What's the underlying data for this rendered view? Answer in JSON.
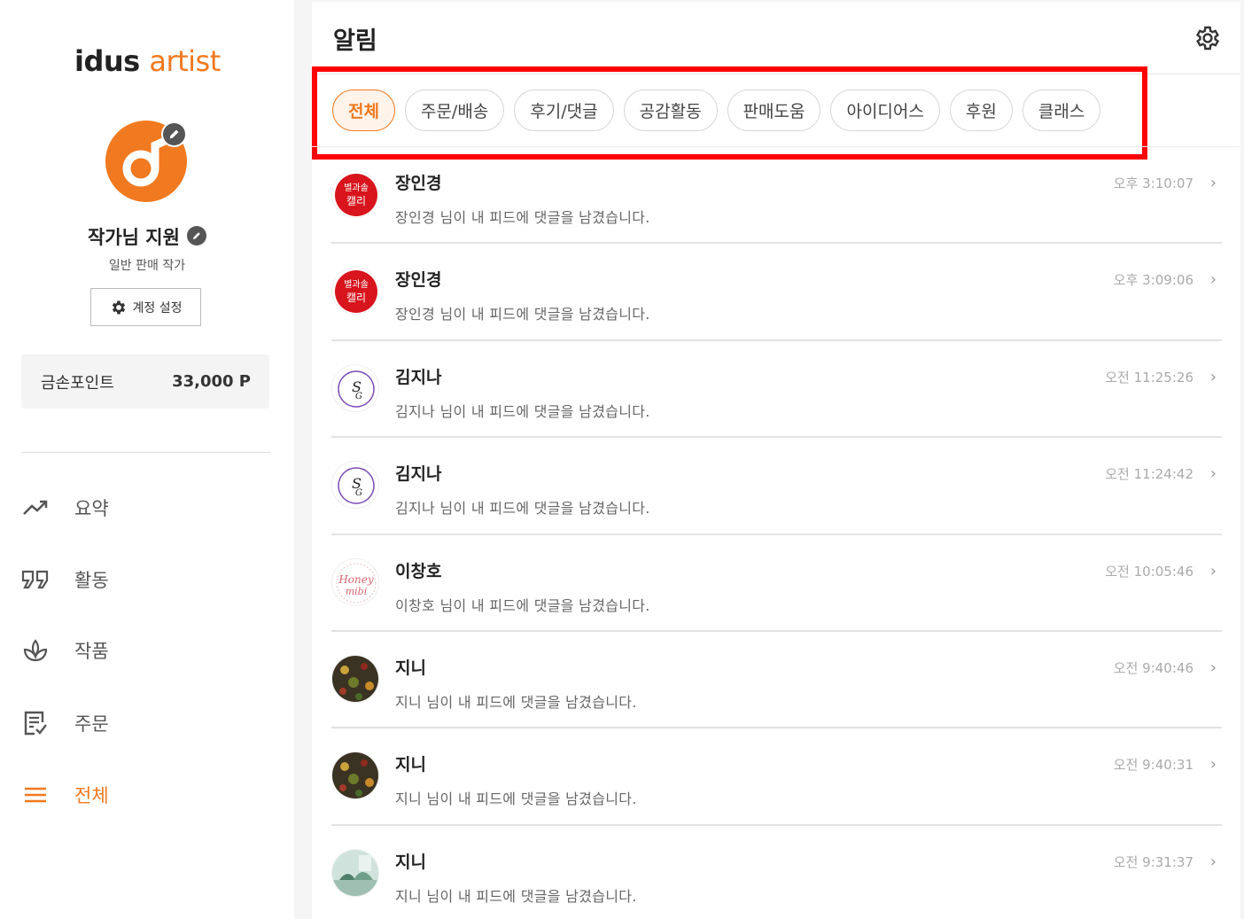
{
  "brand": {
    "logo_main": "idus",
    "logo_sub": "artist",
    "accent": "#f1791f"
  },
  "profile": {
    "name": "작가님 지원",
    "type": "일반 판매 작가",
    "account_settings": "계정 설정"
  },
  "points": {
    "label": "금손포인트",
    "value": "33,000 P"
  },
  "nav": [
    {
      "label": "요약",
      "icon": "trending-up-icon"
    },
    {
      "label": "활동",
      "icon": "quote-icon"
    },
    {
      "label": "작품",
      "icon": "plant-icon"
    },
    {
      "label": "주문",
      "icon": "order-doc-icon"
    },
    {
      "label": "전체",
      "icon": "menu-icon",
      "active": true
    }
  ],
  "main": {
    "title": "알림",
    "filters": [
      "전체",
      "주문/배송",
      "후기/댓글",
      "공감활동",
      "판매도움",
      "아이디어스",
      "후원",
      "클래스"
    ],
    "active_filter": "전체"
  },
  "notifications": [
    {
      "name": "장인경",
      "message": "장인경 님이 내 피드에 댓글을 남겼습니다.",
      "time": "오후 3:10:07",
      "avatar": "red-logo-avatar"
    },
    {
      "name": "장인경",
      "message": "장인경 님이 내 피드에 댓글을 남겼습니다.",
      "time": "오후 3:09:06",
      "avatar": "red-logo-avatar"
    },
    {
      "name": "김지나",
      "message": "김지나 님이 내 피드에 댓글을 남겼습니다.",
      "time": "오전 11:25:26",
      "avatar": "script-logo-avatar"
    },
    {
      "name": "김지나",
      "message": "김지나 님이 내 피드에 댓글을 남겼습니다.",
      "time": "오전 11:24:42",
      "avatar": "script-logo-avatar"
    },
    {
      "name": "이창호",
      "message": "이창호 님이 내 피드에 댓글을 남겼습니다.",
      "time": "오전 10:05:46",
      "avatar": "honey-logo-avatar"
    },
    {
      "name": "지니",
      "message": "지니 님이 내 피드에 댓글을 남겼습니다.",
      "time": "오전 9:40:46",
      "avatar": "photo-avatar"
    },
    {
      "name": "지니",
      "message": "지니 님이 내 피드에 댓글을 남겼습니다.",
      "time": "오전 9:40:31",
      "avatar": "photo-avatar"
    },
    {
      "name": "지니",
      "message": "지니 님이 내 피드에 댓글을 남겼습니다.",
      "time": "오전 9:31:37",
      "avatar": "photo-avatar-2"
    }
  ]
}
